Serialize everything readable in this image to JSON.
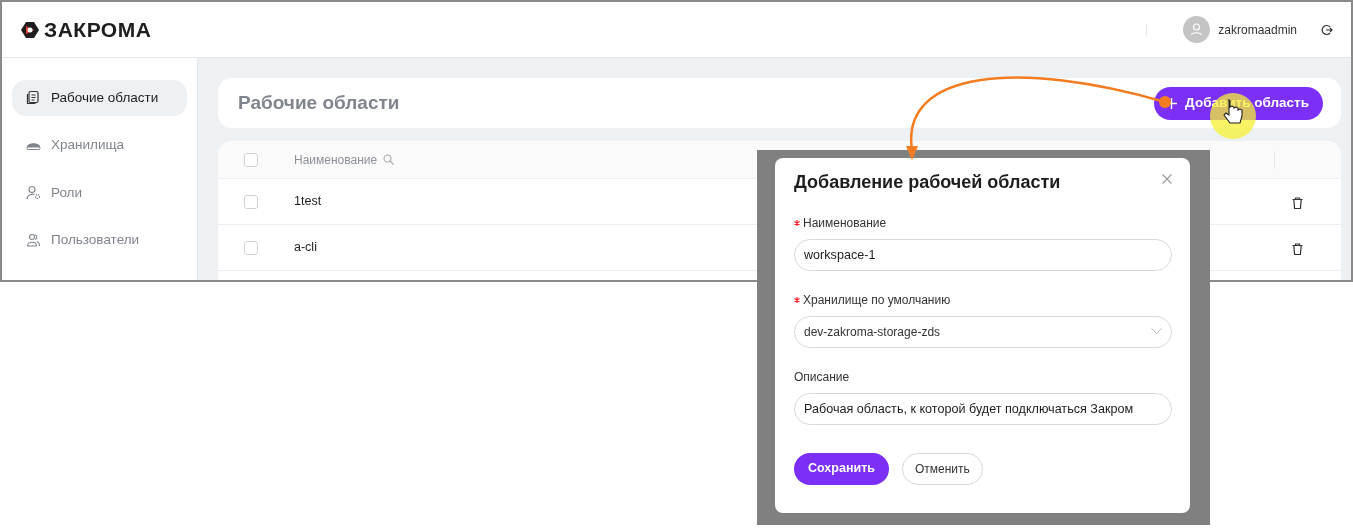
{
  "header": {
    "logo": "ЗАКРОМА",
    "user": "zakromaadmin"
  },
  "sidebar": {
    "items": [
      {
        "label": "Рабочие области",
        "kind": "document",
        "selected": true
      },
      {
        "label": "Хранилища",
        "kind": "storage",
        "selected": false
      },
      {
        "label": "Роли",
        "kind": "roles",
        "selected": false
      },
      {
        "label": "Пользователи",
        "kind": "users",
        "selected": false
      }
    ]
  },
  "page": {
    "title": "Рабочие области",
    "add_button": "Добавить область"
  },
  "table": {
    "header_checked": false,
    "columns": [
      {
        "label": "Наименование"
      }
    ],
    "rows": [
      {
        "name": "1test",
        "checked": false
      },
      {
        "name": "a-cli",
        "checked": false
      }
    ]
  },
  "dialog": {
    "title": "Добавление рабочей области",
    "fields": [
      {
        "label": "Наименование",
        "required": true,
        "kind": "text",
        "value": "workspace-1"
      },
      {
        "label": "Хранилище по умолчанию",
        "required": true,
        "kind": "select",
        "value": "dev-zakroma-storage-zds"
      },
      {
        "label": "Описание",
        "required": false,
        "kind": "text",
        "value": "Рабочая область, к которой будет подключаться Закром"
      }
    ],
    "buttons": [
      {
        "label": "Сохранить",
        "kind": "primary"
      },
      {
        "label": "Отменить",
        "kind": "secondary"
      }
    ]
  }
}
